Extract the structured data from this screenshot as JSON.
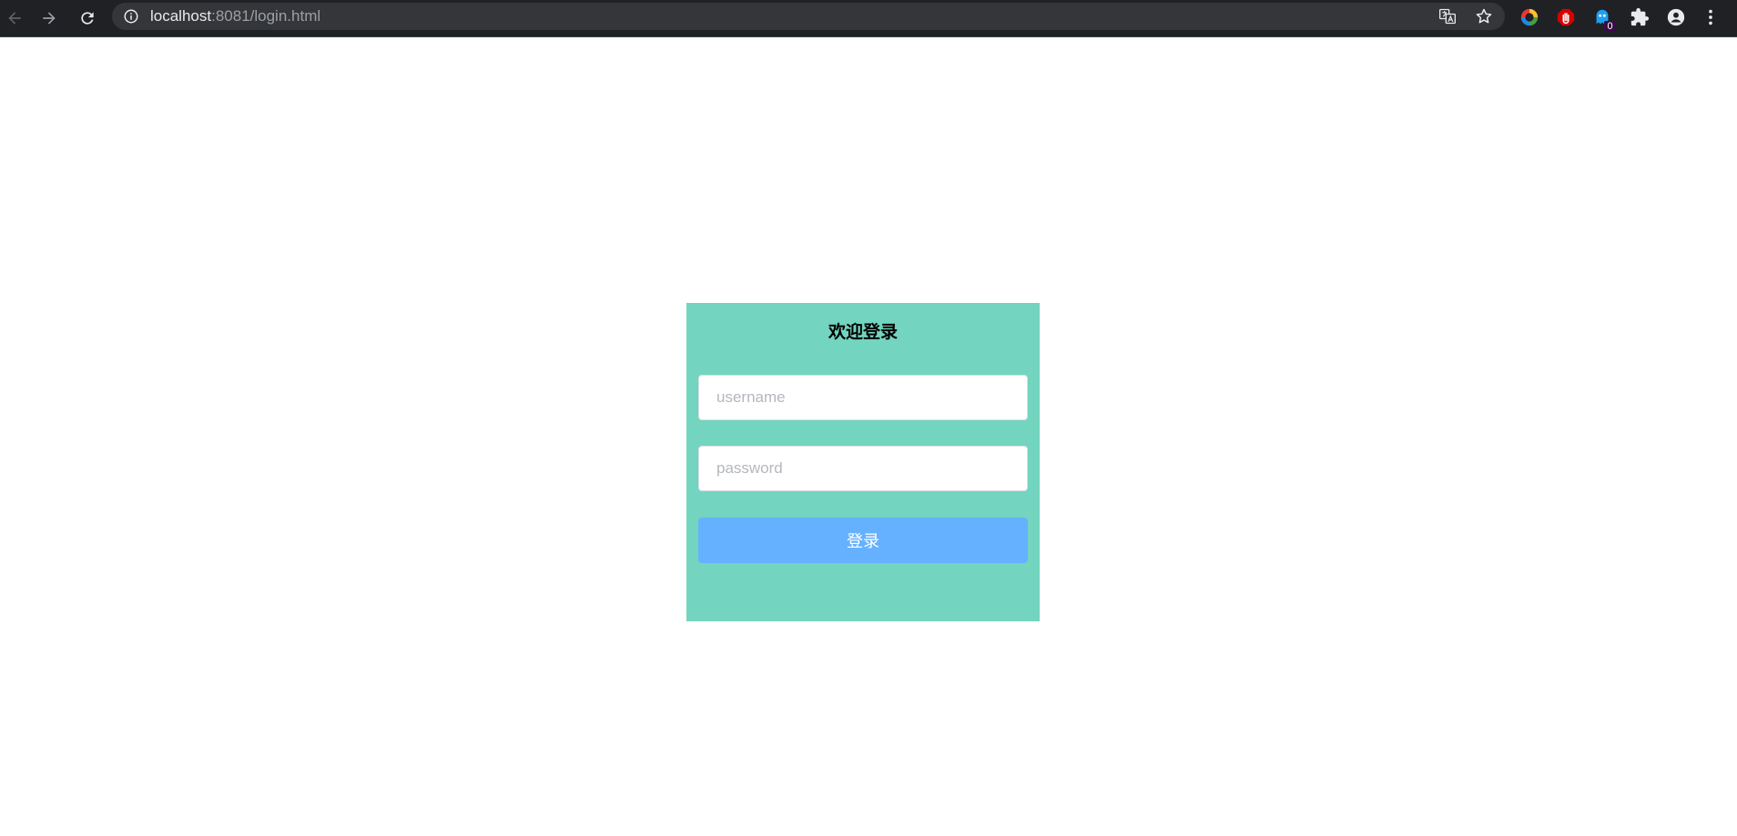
{
  "browser": {
    "url_host": "localhost",
    "url_rest": ":8081/login.html",
    "extension_badge": "0"
  },
  "icons": {
    "back": "arrow-left-icon",
    "forward": "arrow-right-icon",
    "reload": "reload-icon",
    "site_info": "info-icon",
    "translate": "translate-icon",
    "bookmark": "star-icon",
    "ext1": "color-wheel-icon",
    "ext2": "stop-hand-icon",
    "ext3": "ghost-icon",
    "extensions": "puzzle-icon",
    "profile": "account-icon",
    "menu": "kebab-menu-icon"
  },
  "login": {
    "title": "欢迎登录",
    "username_placeholder": "username",
    "username_value": "",
    "password_placeholder": "password",
    "password_value": "",
    "submit_label": "登录"
  },
  "colors": {
    "panel_background": "#73d4bf",
    "button_background": "#66b1ff",
    "chrome_background": "#202124"
  }
}
